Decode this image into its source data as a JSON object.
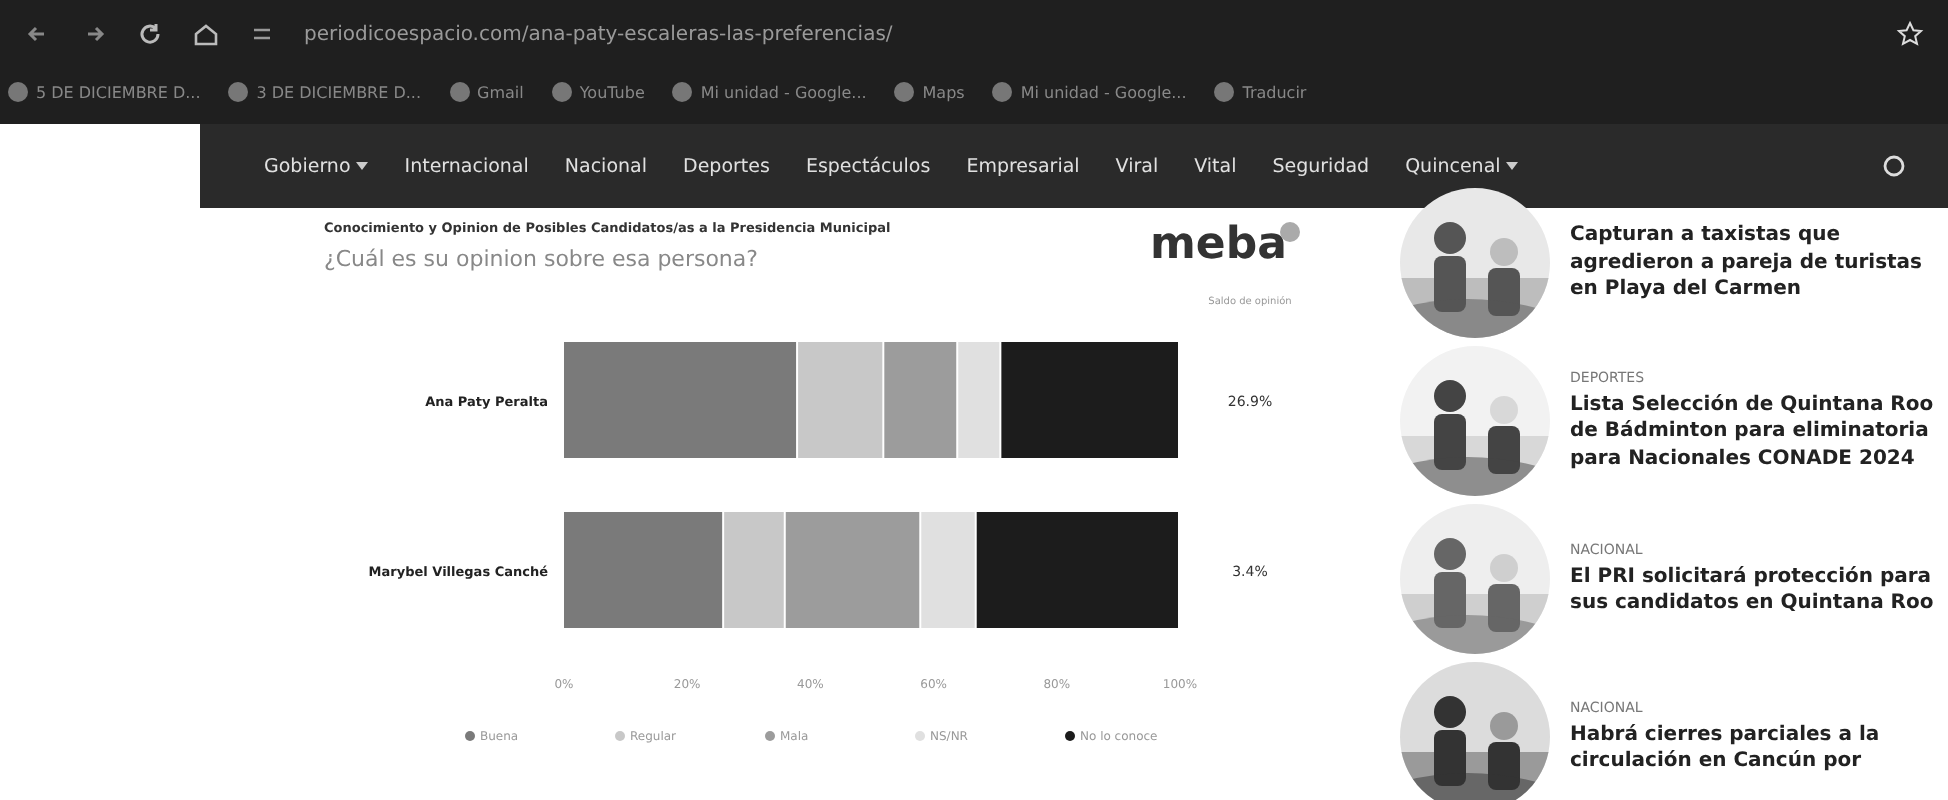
{
  "browser": {
    "url": "periodicoespacio.com/ana-paty-escaleras-las-preferencias/",
    "bookmarks": [
      "5 DE DICIEMBRE D...",
      "3 DE DICIEMBRE D...",
      "Gmail",
      "YouTube",
      "Mi unidad - Google...",
      "Maps",
      "Mi unidad - Google...",
      "Traducir"
    ]
  },
  "nav": {
    "items": [
      {
        "label": "Gobierno",
        "dropdown": true
      },
      {
        "label": "Internacional",
        "dropdown": false
      },
      {
        "label": "Nacional",
        "dropdown": false
      },
      {
        "label": "Deportes",
        "dropdown": false
      },
      {
        "label": "Espectáculos",
        "dropdown": false
      },
      {
        "label": "Empresarial",
        "dropdown": false
      },
      {
        "label": "Viral",
        "dropdown": false
      },
      {
        "label": "Vital",
        "dropdown": false
      },
      {
        "label": "Seguridad",
        "dropdown": false
      },
      {
        "label": "Quincenal",
        "dropdown": true
      }
    ]
  },
  "infographic": {
    "title": "Conocimiento y Opinion de Posibles Candidatos/as a la Presidencia Municipal",
    "question": "¿Cuál es su opinion sobre esa persona?",
    "logo": "meba",
    "balance_header": "Saldo de opinión",
    "rows": [
      {
        "balance": "26.9%"
      },
      {
        "balance": "3.4%"
      }
    ],
    "chart_data": {
      "type": "bar",
      "orientation": "horizontal",
      "stacked": true,
      "legend": "bottom",
      "categories": [
        "Ana Paty Peralta",
        "Marybel Villegas Canché"
      ],
      "xlim": [
        0,
        100
      ],
      "xticks": [
        {
          "value": 0,
          "label": "0%"
        },
        {
          "value": 20,
          "label": "20%"
        },
        {
          "value": 40,
          "label": "40%"
        },
        {
          "value": 60,
          "label": "60%"
        },
        {
          "value": 80,
          "label": "80%"
        },
        {
          "value": 100,
          "label": "100%"
        }
      ],
      "series": [
        {
          "name": "Buena",
          "color": "#7a7a7a",
          "values": [
            38,
            26
          ]
        },
        {
          "name": "Regular",
          "color": "#c8c8c8",
          "values": [
            14,
            10
          ]
        },
        {
          "name": "Mala",
          "color": "#9c9c9c",
          "values": [
            12,
            22
          ]
        },
        {
          "name": "NS/NR",
          "color": "#e0e0e0",
          "values": [
            7,
            9
          ]
        },
        {
          "name": "No lo conoce",
          "color": "#1c1c1c",
          "values": [
            29,
            33
          ]
        }
      ]
    }
  },
  "sidebar": {
    "items": [
      {
        "headline": "Capturan a taxistas que agredieron a pareja de turistas en Playa del Carmen"
      },
      {
        "category": "DEPORTES",
        "headline": "Lista Selección de Quintana Roo de Bádminton para eliminatoria para Nacionales CONADE 2024"
      },
      {
        "category": "NACIONAL",
        "headline": "El PRI solicitará protección para sus candidatos en Quintana Roo"
      },
      {
        "category": "NACIONAL",
        "headline": "Habrá cierres parciales a la circulación en Cancún por"
      }
    ]
  }
}
